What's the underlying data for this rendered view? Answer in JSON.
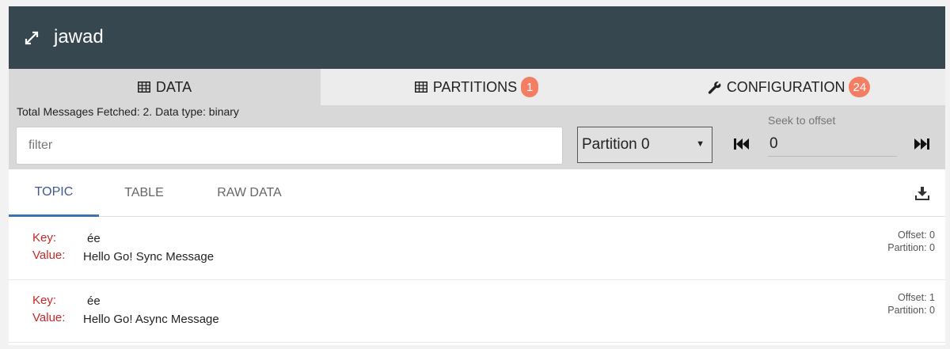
{
  "header": {
    "title": "jawad"
  },
  "tabs": [
    {
      "label": "DATA",
      "icon": "table-icon"
    },
    {
      "label": "PARTITIONS",
      "icon": "table-icon",
      "badge": "1"
    },
    {
      "label": "CONFIGURATION",
      "icon": "wrench-icon",
      "badge": "24"
    }
  ],
  "toolbar": {
    "summary": "Total Messages Fetched: 2. Data type: binary",
    "filter_placeholder": "filter",
    "partition_selected": "Partition 0",
    "seek_label": "Seek to offset",
    "seek_value": "0"
  },
  "subtabs": [
    {
      "label": "TOPIC"
    },
    {
      "label": "TABLE"
    },
    {
      "label": "RAW DATA"
    }
  ],
  "messages": [
    {
      "key_label": "Key:",
      "key": "ée",
      "value_label": "Value:",
      "value": "Hello Go! Sync Message",
      "offset": "Offset: 0",
      "partition": "Partition: 0"
    },
    {
      "key_label": "Key:",
      "key": "ée",
      "value_label": "Value:",
      "value": "Hello Go! Async Message",
      "offset": "Offset: 1",
      "partition": "Partition: 0"
    }
  ],
  "colors": {
    "header_bg": "#37474f",
    "badge": "#f47e63",
    "key_label": "#c62828",
    "active_subtab": "#3f6fb5"
  }
}
